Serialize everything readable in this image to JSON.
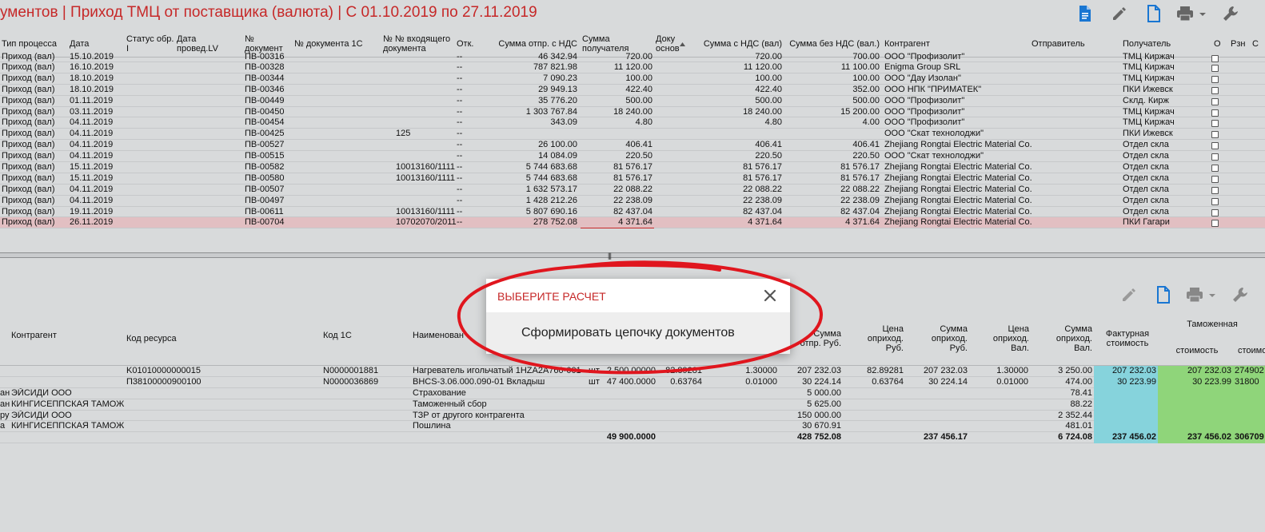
{
  "title": "ументов | Приход ТМЦ от поставщика (валюта) | С 01.10.2019 по 27.11.2019",
  "toolbar_icons": [
    "document-blue-icon",
    "pencil-icon",
    "new-document-icon",
    "printer-icon",
    "wrench-icon"
  ],
  "colors": {
    "accent_red": "#c62828",
    "icon_blue": "#1976d2",
    "selected_row": "#e2bfc2",
    "cyan_cell": "#86d3dc",
    "green_cell": "#8fd57a"
  },
  "headers": {
    "type": "Тип процесса",
    "date": "Дата",
    "status": "Статус обр. I",
    "date_lv": "Дата провед.LV",
    "docnum": "№ документ",
    "doc1c": "№ документа 1С",
    "incoming": "№ № входящего документа",
    "otk": "Отк.",
    "sum_otpr": "Сумма отпр. с НДС",
    "sum_pol": "Сумма получателя",
    "doc_osn": "Доку основ",
    "sum_nds_val": "Сумма с НДС (вал)",
    "sum_bez_nds": "Сумма без НДС (вал.)",
    "contractor": "Контрагент",
    "sender": "Отправитель",
    "receiver": "Получатель",
    "o": "О",
    "rzn": "Рзн",
    "c": "С"
  },
  "rows": [
    {
      "type": "Приход (вал)",
      "date": "15.10.2019",
      "docnum": "ПВ-00316",
      "incoming": "",
      "otk": "--",
      "sum_otpr": "46 342.94",
      "sum_pol": "720.00",
      "sum_nds": "720.00",
      "sum_bez": "700.00",
      "contractor": "ООО \"Профизолит\"",
      "receiver": "ТМЦ Киржач"
    },
    {
      "type": "Приход (вал)",
      "date": "16.10.2019",
      "docnum": "ПВ-00328",
      "incoming": "",
      "otk": "--",
      "sum_otpr": "787 821.98",
      "sum_pol": "11 120.00",
      "sum_nds": "11 120.00",
      "sum_bez": "11 100.00",
      "contractor": "Enigma Group SRL",
      "receiver": "ТМЦ Киржач"
    },
    {
      "type": "Приход (вал)",
      "date": "18.10.2019",
      "docnum": "ПВ-00344",
      "incoming": "",
      "otk": "--",
      "sum_otpr": "7 090.23",
      "sum_pol": "100.00",
      "sum_nds": "100.00",
      "sum_bez": "100.00",
      "contractor": "ООО \"Дау Изолан\"",
      "receiver": "ТМЦ Киржач"
    },
    {
      "type": "Приход (вал)",
      "date": "18.10.2019",
      "docnum": "ПВ-00346",
      "incoming": "",
      "otk": "--",
      "sum_otpr": "29 949.13",
      "sum_pol": "422.40",
      "sum_nds": "422.40",
      "sum_bez": "352.00",
      "contractor": "ООО НПК \"ПРИМАТЕК\"",
      "receiver": "ПКИ Ижевск"
    },
    {
      "type": "Приход (вал)",
      "date": "01.11.2019",
      "docnum": "ПВ-00449",
      "incoming": "",
      "otk": "--",
      "sum_otpr": "35 776.20",
      "sum_pol": "500.00",
      "sum_nds": "500.00",
      "sum_bez": "500.00",
      "contractor": "ООО \"Профизолит\"",
      "receiver": "Склд. Кирж"
    },
    {
      "type": "Приход (вал)",
      "date": "03.11.2019",
      "docnum": "ПВ-00450",
      "incoming": "",
      "otk": "--",
      "sum_otpr": "1 303 767.84",
      "sum_pol": "18 240.00",
      "sum_nds": "18 240.00",
      "sum_bez": "15 200.00",
      "contractor": "ООО \"Профизолит\"",
      "receiver": "ТМЦ Киржач"
    },
    {
      "type": "Приход (вал)",
      "date": "04.11.2019",
      "docnum": "ПВ-00454",
      "incoming": "",
      "otk": "--",
      "sum_otpr": "343.09",
      "sum_pol": "4.80",
      "sum_nds": "4.80",
      "sum_bez": "4.00",
      "contractor": "ООО \"Профизолит\"",
      "receiver": "ТМЦ Киржач"
    },
    {
      "type": "Приход (вал)",
      "date": "04.11.2019",
      "docnum": "ПВ-00425",
      "incoming": "125",
      "otk": "--",
      "sum_otpr": "",
      "sum_pol": "",
      "sum_nds": "",
      "sum_bez": "",
      "contractor": "ООО \"Скат технолоджи\"",
      "receiver": "ПКИ Ижевск"
    },
    {
      "type": "Приход (вал)",
      "date": "04.11.2019",
      "docnum": "ПВ-00527",
      "incoming": "",
      "otk": "--",
      "sum_otpr": "26 100.00",
      "sum_pol": "406.41",
      "sum_nds": "406.41",
      "sum_bez": "406.41",
      "contractor": "Zhejiang Rongtai Electric Material Co.,",
      "receiver": "Отдел скла"
    },
    {
      "type": "Приход (вал)",
      "date": "04.11.2019",
      "docnum": "ПВ-00515",
      "incoming": "",
      "otk": "--",
      "sum_otpr": "14 084.09",
      "sum_pol": "220.50",
      "sum_nds": "220.50",
      "sum_bez": "220.50",
      "contractor": "ООО \"Скат технолоджи\"",
      "receiver": "Отдел скла"
    },
    {
      "type": "Приход (вал)",
      "date": "15.11.2019",
      "docnum": "ПВ-00582",
      "incoming": "10013160/1111",
      "otk": "--",
      "sum_otpr": "5 744 683.68",
      "sum_pol": "81 576.17",
      "sum_nds": "81 576.17",
      "sum_bez": "81 576.17",
      "contractor": "Zhejiang Rongtai Electric Material Co.,",
      "receiver": "Отдел скла"
    },
    {
      "type": "Приход (вал)",
      "date": "15.11.2019",
      "docnum": "ПВ-00580",
      "incoming": "10013160/1111",
      "otk": "--",
      "sum_otpr": "5 744 683.68",
      "sum_pol": "81 576.17",
      "sum_nds": "81 576.17",
      "sum_bez": "81 576.17",
      "contractor": "Zhejiang Rongtai Electric Material Co.,",
      "receiver": "Отдел скла"
    },
    {
      "type": "Приход (вал)",
      "date": "04.11.2019",
      "docnum": "ПВ-00507",
      "incoming": "",
      "otk": "--",
      "sum_otpr": "1 632 573.17",
      "sum_pol": "22 088.22",
      "sum_nds": "22 088.22",
      "sum_bez": "22 088.22",
      "contractor": "Zhejiang Rongtai Electric Material Co.,",
      "receiver": "Отдел скла"
    },
    {
      "type": "Приход (вал)",
      "date": "04.11.2019",
      "docnum": "ПВ-00497",
      "incoming": "",
      "otk": "--",
      "sum_otpr": "1 428 212.26",
      "sum_pol": "22 238.09",
      "sum_nds": "22 238.09",
      "sum_bez": "22 238.09",
      "contractor": "Zhejiang Rongtai Electric Material Co.,",
      "receiver": "Отдел скла"
    },
    {
      "type": "Приход (вал)",
      "date": "19.11.2019",
      "docnum": "ПВ-00611",
      "incoming": "10013160/1111",
      "otk": "--",
      "sum_otpr": "5 807 690.16",
      "sum_pol": "82 437.04",
      "sum_nds": "82 437.04",
      "sum_bez": "82 437.04",
      "contractor": "Zhejiang Rongtai Electric Material Co.,",
      "receiver": "Отдел скла"
    },
    {
      "type": "Приход (вал)",
      "date": "26.11.2019",
      "docnum": "ПВ-00704",
      "incoming": "10702070/2011",
      "otk": "--",
      "sum_otpr": "278 752.08",
      "sum_pol": "4 371.64",
      "sum_nds": "4 371.64",
      "sum_bez": "4 371.64",
      "contractor": "Zhejiang Rongtai Electric Material Co.,",
      "receiver": "ПКИ Гагари"
    }
  ],
  "lower_toolbar_icons": [
    "pencil-icon",
    "new-document-icon",
    "printer-icon",
    "wrench-icon"
  ],
  "lower_headers": {
    "contractor": "Контрагент",
    "code_resource": "Код ресурса",
    "code1c": "Код 1С",
    "name": "Наименован",
    "sum_otpr_rub": "Сумма отпр. Руб.",
    "price_rub": "Цена оприход. Руб.",
    "sum_rub": "Сумма оприход. Руб.",
    "price_val": "Цена оприход. Вал.",
    "sum_val": "Сумма оприход. Вал.",
    "invoice": "Фактурная стоимость",
    "customs": "Таможенная",
    "customs_cost": "стоимость",
    "customs_cost2": "стоимо"
  },
  "lower_rows": [
    {
      "pre": "",
      "contractor": "",
      "code": "K01010000000015",
      "code1c": "N0000001881",
      "name": "Нагреватель игольчатый 1HZA2A760-001",
      "unit": "шт",
      "qty": "2 500.00000",
      "p1": "82.89281",
      "p2": "1.30000",
      "sum_otpr": "207 232.03",
      "price_rub": "82.89281",
      "sum_rub": "207 232.03",
      "price_val": "1.30000",
      "sum_val": "3 250.00",
      "invoice": "207 232.03",
      "customs": "207 232.03",
      "customs2": "274902"
    },
    {
      "pre": "",
      "contractor": "",
      "code": "П38100000900100",
      "code1c": "N0000036869",
      "name": "BHCS-3.06.000.090-01 Вкладыш",
      "unit": "шт",
      "qty": "47 400.0000",
      "p1": "0.63764",
      "p2": "0.01000",
      "sum_otpr": "30 224.14",
      "price_rub": "0.63764",
      "sum_rub": "30 224.14",
      "price_val": "0.01000",
      "sum_val": "474.00",
      "invoice": "30 223.99",
      "customs": "30 223.99",
      "customs2": "31800"
    },
    {
      "pre": "ан",
      "contractor": "ЭЙСИДИ ООО",
      "code": "",
      "code1c": "",
      "name": "Страхование",
      "unit": "",
      "qty": "",
      "p1": "",
      "p2": "",
      "sum_otpr": "5 000.00",
      "price_rub": "",
      "sum_rub": "",
      "price_val": "",
      "sum_val": "78.41",
      "invoice": "",
      "customs": "",
      "customs2": ""
    },
    {
      "pre": "ан",
      "contractor": "КИНГИСЕППСКАЯ ТАМОЖН",
      "code": "",
      "code1c": "",
      "name": "Таможенный сбор",
      "unit": "",
      "qty": "",
      "p1": "",
      "p2": "",
      "sum_otpr": "5 625.00",
      "price_rub": "",
      "sum_rub": "",
      "price_val": "",
      "sum_val": "88.22",
      "invoice": "",
      "customs": "",
      "customs2": ""
    },
    {
      "pre": "ру",
      "contractor": "ЭЙСИДИ ООО",
      "code": "",
      "code1c": "",
      "name": "ТЗР от другого контрагента",
      "unit": "",
      "qty": "",
      "p1": "",
      "p2": "",
      "sum_otpr": "150 000.00",
      "price_rub": "",
      "sum_rub": "",
      "price_val": "",
      "sum_val": "2 352.44",
      "invoice": "",
      "customs": "",
      "customs2": ""
    },
    {
      "pre": "а",
      "contractor": "КИНГИСЕППСКАЯ ТАМОЖН",
      "code": "",
      "code1c": "",
      "name": "Пошлина",
      "unit": "",
      "qty": "",
      "p1": "",
      "p2": "",
      "sum_otpr": "30 670.91",
      "price_rub": "",
      "sum_rub": "",
      "price_val": "",
      "sum_val": "481.01",
      "invoice": "",
      "customs": "",
      "customs2": ""
    }
  ],
  "lower_total": {
    "qty": "49 900.0000",
    "sum_otpr": "428 752.08",
    "sum_rub": "237 456.17",
    "sum_val": "6 724.08",
    "invoice": "237 456.02",
    "customs": "237 456.02",
    "customs2": "306709"
  },
  "dialog": {
    "title": "ВЫБЕРИТЕ РАСЧЕТ",
    "option": "Сформировать цепочку документов",
    "close_icon": "close-icon"
  },
  "splitter_grip": "|||"
}
